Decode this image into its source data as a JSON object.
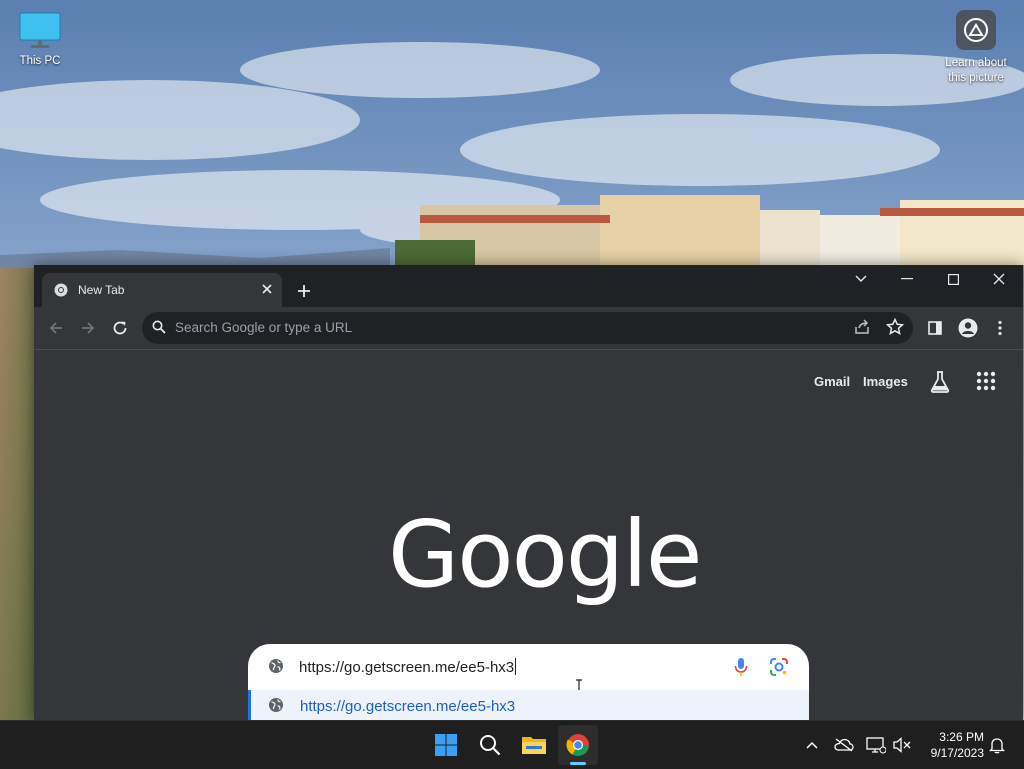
{
  "desktop": {
    "this_pc_label": "This PC",
    "learn_label_line1": "Learn about",
    "learn_label_line2": "this picture"
  },
  "browser": {
    "tab_title": "New Tab",
    "omnibox_placeholder": "Search Google or type a URL",
    "gmail_link": "Gmail",
    "images_link": "Images",
    "logo_text": "Google",
    "search_input_value": "https://go.getscreen.me/ee5-hx3",
    "suggestion_text": "https://go.getscreen.me/ee5-hx3"
  },
  "taskbar": {
    "time": "3:26 PM",
    "date": "9/17/2023",
    "apps": [
      "start-icon",
      "search-icon",
      "file-explorer-icon",
      "chrome-icon"
    ]
  },
  "colors": {
    "chrome_dark": "#202124",
    "ntp_bg": "#35363a",
    "suggestion_link": "#1a5fc8",
    "accent": "#1a73e8"
  }
}
